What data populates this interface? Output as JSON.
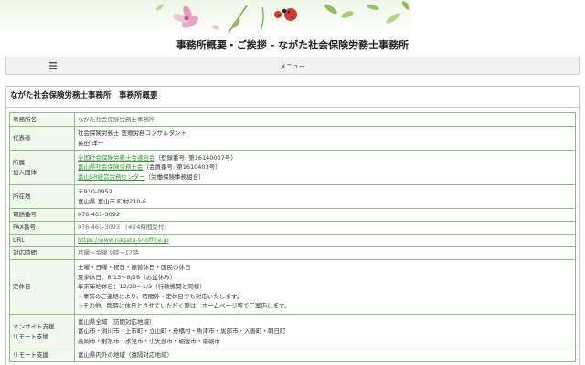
{
  "header": {
    "title": "事務所概要・ご挨拶 - ながた社会保険労務士事務所"
  },
  "menu": {
    "label": "メニュー",
    "icon": "hamburger-icon"
  },
  "page_heading": "ながた社会保険労務士事務所　事務所概要",
  "rows": {
    "office_name": {
      "label": "事務所名",
      "value": "ながた社会保険労務士事務所"
    },
    "representative": {
      "label": "代表者",
      "line1": "社会保険労務士 医療労務コンサルタント",
      "line2": "長田 洋一"
    },
    "affiliation": {
      "label1": "所属",
      "label2": "加入団体",
      "link1": "全国社会保険労務士会連合会",
      "note1": "（登録番号: 第16140007号）",
      "link2": "富山県社会保険労務士会",
      "note2": "（会員番号: 第1610403号）",
      "link3": "富山SR経営労務センター",
      "note3": "（労働保険事務組合）"
    },
    "address": {
      "label": "所在地",
      "postal": "〒930-0952",
      "street": "富山県 富山市 町村210-6"
    },
    "phone": {
      "label": "電話番号",
      "value": "076-461-3092"
    },
    "fax": {
      "label": "FAX番号",
      "value": "076-461-3093 （※24時間受付）"
    },
    "url": {
      "label": "URL",
      "value": "https://www.nagata-sr-office.jp"
    },
    "hours": {
      "label": "対応時間",
      "value": "月曜～金曜 9時～17時"
    },
    "holidays": {
      "label": "定休日",
      "line1": "土曜・日曜・祝日・振替休日・国民の休日",
      "line2": "夏季休日：8/13～8/16（お盆休み）",
      "line3": "年末年始休日：12/29～1/3（行政機関と同様）",
      "line4": "☆事前のご連絡により、時間外・定休日でも対応いたします。",
      "line5": "☆その他、臨時に休日とさせていただく際は、ホームページ等でご案内します。"
    },
    "onsite": {
      "label1": "オンサイト支援",
      "label2": "リモート支援",
      "line1": "富山県全域（訪問対応地域）",
      "line2": "富山市・滑川市・上市町・立山町・舟橋村・魚津市・黒部市・入善町・朝日町",
      "line3": "高岡市・射水市・氷見市・小矢部市・砺波市・南砺市"
    },
    "remote": {
      "label": "リモート支援",
      "line1": "富山県内外の地域（遠隔対応地域）"
    }
  },
  "colors": {
    "border": "#8cc084",
    "label_bg": "#f1f8ee",
    "link": "#2d9a2d"
  }
}
